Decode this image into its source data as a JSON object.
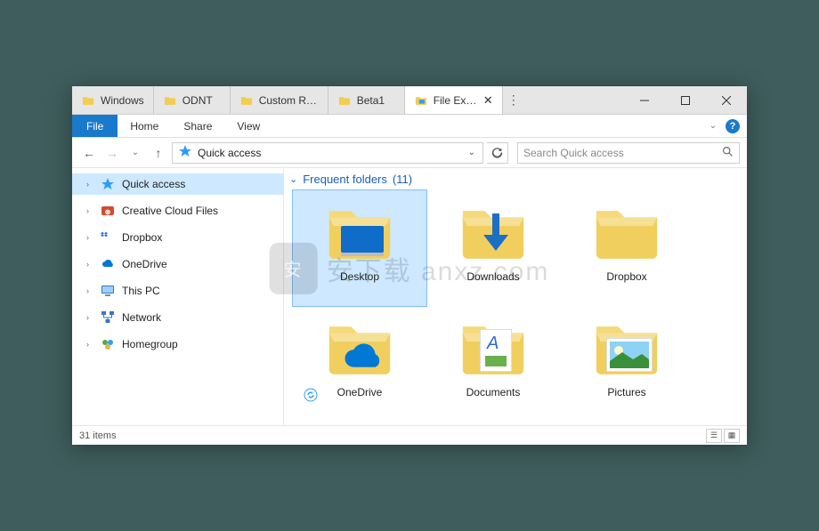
{
  "tabs": [
    {
      "label": "Windows",
      "active": false,
      "icon": "folder"
    },
    {
      "label": "ODNT",
      "active": false,
      "icon": "folder"
    },
    {
      "label": "Custom RT...",
      "active": false,
      "icon": "folder"
    },
    {
      "label": "Beta1",
      "active": false,
      "icon": "folder"
    },
    {
      "label": "File Expl...",
      "active": true,
      "icon": "explorer",
      "closable": true
    }
  ],
  "ribbon": {
    "file": "File",
    "tabs": [
      "Home",
      "Share",
      "View"
    ]
  },
  "address": {
    "crumb": "Quick access"
  },
  "search": {
    "placeholder": "Search Quick access"
  },
  "sidebar": [
    {
      "label": "Quick access",
      "icon": "star",
      "selected": true,
      "expandable": true
    },
    {
      "label": "Creative Cloud Files",
      "icon": "cc",
      "expandable": true,
      "group": true
    },
    {
      "label": "Dropbox",
      "icon": "dropbox",
      "expandable": true,
      "group": true
    },
    {
      "label": "OneDrive",
      "icon": "onedrive",
      "expandable": true,
      "group": true
    },
    {
      "label": "This PC",
      "icon": "pc",
      "expandable": true,
      "group": true
    },
    {
      "label": "Network",
      "icon": "network",
      "expandable": true,
      "group": true
    },
    {
      "label": "Homegroup",
      "icon": "homegroup",
      "expandable": true,
      "group": true
    }
  ],
  "section": {
    "title": "Frequent folders",
    "count": "(11)"
  },
  "tiles": [
    {
      "label": "Desktop",
      "icon": "desktop",
      "selected": true
    },
    {
      "label": "Downloads",
      "icon": "downloads"
    },
    {
      "label": "Dropbox",
      "icon": "dropbox-folder"
    },
    {
      "label": "OneDrive",
      "icon": "onedrive-folder",
      "sync": true
    },
    {
      "label": "Documents",
      "icon": "documents"
    },
    {
      "label": "Pictures",
      "icon": "pictures"
    }
  ],
  "status": {
    "text": "31 items"
  },
  "watermark": "安下载 anxz.com"
}
